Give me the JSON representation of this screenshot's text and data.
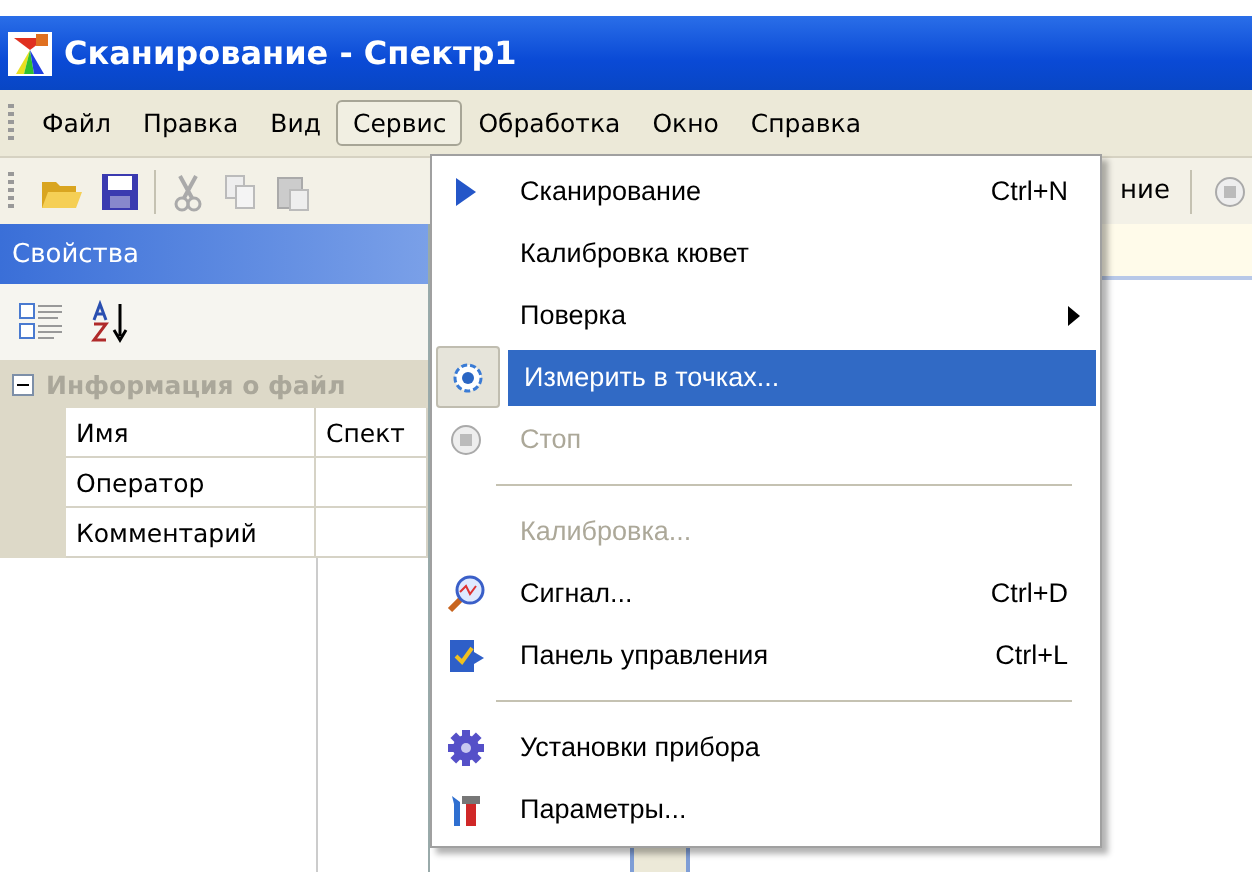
{
  "window": {
    "title": "Сканирование - Спектр1"
  },
  "menu_bar": [
    {
      "label": "Файл",
      "selected": false
    },
    {
      "label": "Правка",
      "selected": false
    },
    {
      "label": "Вид",
      "selected": false
    },
    {
      "label": "Сервис",
      "selected": true
    },
    {
      "label": "Обработка",
      "selected": false
    },
    {
      "label": "Окно",
      "selected": false
    },
    {
      "label": "Справка",
      "selected": false
    }
  ],
  "toolbar": {
    "button_label": "ние"
  },
  "properties": {
    "title": "Свойства",
    "group": {
      "label": "Информация о файл",
      "expanded": true
    },
    "rows": [
      {
        "name": "Имя",
        "value": "Спект"
      },
      {
        "name": "Оператор"
      },
      {
        "name": "Комментарий"
      }
    ]
  },
  "dropdown": [
    {
      "kind": "item",
      "label": "Сканирование",
      "shortcut": "Ctrl+N",
      "disabled": false,
      "selected": false
    },
    {
      "kind": "item",
      "label": "Калибровка кювет",
      "disabled": false,
      "selected": false
    },
    {
      "kind": "item",
      "label": "Поверка",
      "submenu": true,
      "disabled": false,
      "selected": false
    },
    {
      "kind": "item",
      "label": "Измерить в точках...",
      "disabled": false,
      "selected": true
    },
    {
      "kind": "item",
      "label": "Стоп",
      "disabled": true,
      "selected": false
    },
    {
      "kind": "separator"
    },
    {
      "kind": "item",
      "label": "Калибровка...",
      "disabled": true,
      "selected": false
    },
    {
      "kind": "item",
      "label": "Сигнал...",
      "shortcut": "Ctrl+D",
      "disabled": false,
      "selected": false
    },
    {
      "kind": "item",
      "label": "Панель управления",
      "shortcut": "Ctrl+L",
      "disabled": false,
      "selected": false
    },
    {
      "kind": "separator"
    },
    {
      "kind": "item",
      "label": "Установки прибора",
      "disabled": false,
      "selected": false
    },
    {
      "kind": "item",
      "label": "Параметры...",
      "disabled": false,
      "selected": false
    }
  ]
}
